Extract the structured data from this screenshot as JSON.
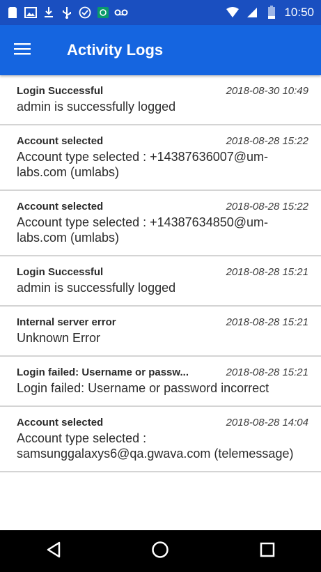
{
  "status_bar": {
    "time": "10:50",
    "left_icons": [
      "sim-card-icon",
      "image-icon",
      "download-icon",
      "usb-icon",
      "check-circle-icon",
      "app-badge-icon",
      "voicemail-icon"
    ],
    "right_icons": [
      "wifi-icon",
      "signal-icon",
      "battery-icon"
    ]
  },
  "app_bar": {
    "title": "Activity Logs",
    "menu_icon": "hamburger-menu-icon",
    "background": "#1565e0",
    "status_background": "#1a4fc0"
  },
  "logs": [
    {
      "title": "Login Successful",
      "time": "2018-08-30 10:49",
      "message": "admin is successfully logged"
    },
    {
      "title": "Account selected",
      "time": "2018-08-28 15:22",
      "message": "Account type selected : +14387636007@um-labs.com (umlabs)"
    },
    {
      "title": "Account selected",
      "time": "2018-08-28 15:22",
      "message": "Account type selected : +14387634850@um-labs.com (umlabs)"
    },
    {
      "title": "Login Successful",
      "time": "2018-08-28 15:21",
      "message": "admin is successfully logged"
    },
    {
      "title": "Internal server error",
      "time": "2018-08-28 15:21",
      "message": "Unknown Error"
    },
    {
      "title": "Login failed: Username or passw...",
      "time": "2018-08-28 15:21",
      "message": "Login failed: Username or password incorrect"
    },
    {
      "title": "Account selected",
      "time": "2018-08-28 14:04",
      "message": "Account type selected : samsunggalaxys6@qa.gwava.com (telemessage)"
    }
  ],
  "nav_bar": {
    "buttons": [
      "back-icon",
      "home-icon",
      "recents-icon"
    ]
  }
}
